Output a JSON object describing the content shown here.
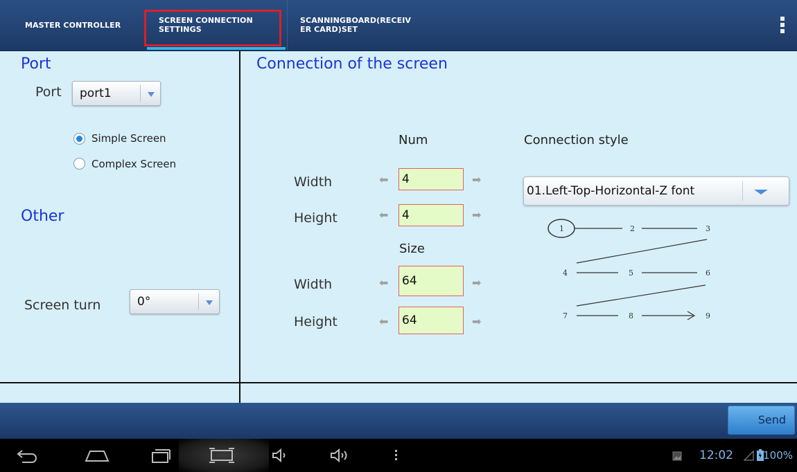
{
  "tabs": [
    {
      "label": "MASTER CONTROLLER"
    },
    {
      "label_line1": "SCREEN CONNECTION",
      "label_line2": "SETTINGS"
    },
    {
      "label_line1": "SCANNINGBOARD(RECEIV",
      "label_line2": "ER CARD)SET"
    }
  ],
  "port": {
    "section_title": "Port",
    "label": "Port",
    "value": "port1",
    "options": {
      "simple": "Simple Screen",
      "complex": "Complex Screen",
      "selected": "simple"
    }
  },
  "other": {
    "section_title": "Other",
    "screen_turn_label": "Screen turn",
    "screen_turn_value": "0°"
  },
  "connection": {
    "section_title": "Connection of the screen",
    "num_header": "Num",
    "size_header": "Size",
    "num_width_label": "Width",
    "num_height_label": "Height",
    "size_width_label": "Width",
    "size_height_label": "Height",
    "num_width": "4",
    "num_height": "4",
    "size_width": "64",
    "size_height": "64",
    "style_header": "Connection style",
    "style_value": "01.Left-Top-Horizontal-Z font",
    "diagram_labels": [
      "1",
      "2",
      "3",
      "4",
      "5",
      "6",
      "7",
      "8",
      "9"
    ]
  },
  "send_label": "Send",
  "status": {
    "time": "12:02",
    "battery": "100%"
  },
  "icons": [
    "back-icon",
    "home-icon",
    "recent-apps-icon",
    "screenshot-icon",
    "volume-down-icon",
    "volume-up-icon",
    "menu-icon",
    "gallery-icon",
    "signal-icon",
    "battery-icon"
  ],
  "colors": {
    "accent": "#33b5e5",
    "section_title": "#1a35d6",
    "field_bg": "#e5fbc7",
    "field_border": "#e06060",
    "highlight_box": "#d9202b"
  }
}
